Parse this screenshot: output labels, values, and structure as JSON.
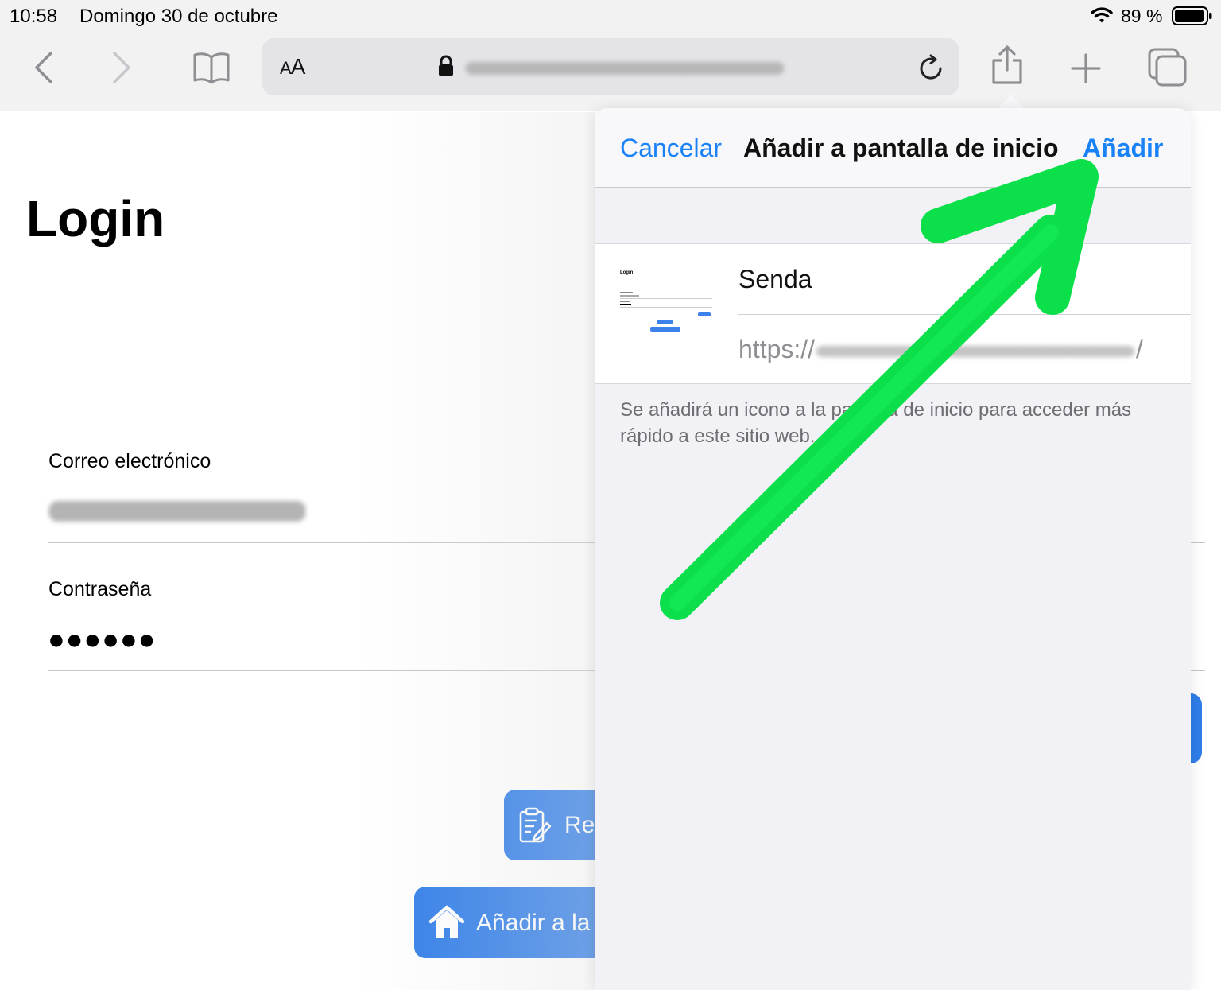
{
  "status_bar": {
    "time": "10:58",
    "date": "Domingo 30 de octubre",
    "battery": "89 %"
  },
  "toolbar": {
    "text_size_label": "AA",
    "icons": [
      "chevron-left-icon",
      "chevron-right-icon",
      "bookmarks-icon",
      "lock-icon",
      "reload-icon",
      "share-icon",
      "plus-icon",
      "tabs-icon"
    ]
  },
  "page": {
    "title": "Login",
    "email_label": "Correo electrónico",
    "password_label": "Contraseña",
    "password_value": "●●●●●●",
    "register_button": "Re",
    "add_home_button": "Añadir a la"
  },
  "sheet": {
    "cancel": "Cancelar",
    "title": "Añadir a pantalla de inicio",
    "add": "Añadir",
    "app_name": "Senda",
    "url_prefix": "https://",
    "url_suffix": "/",
    "hint": "Se añadirá un icono a la pantalla de inicio para acceder más rápido a este sitio web.",
    "thumbnail_title": "Login"
  },
  "colors": {
    "accent_blue": "#1a82f7",
    "button_blue": "#2f7de9",
    "arrow_green": "#0be04a"
  }
}
